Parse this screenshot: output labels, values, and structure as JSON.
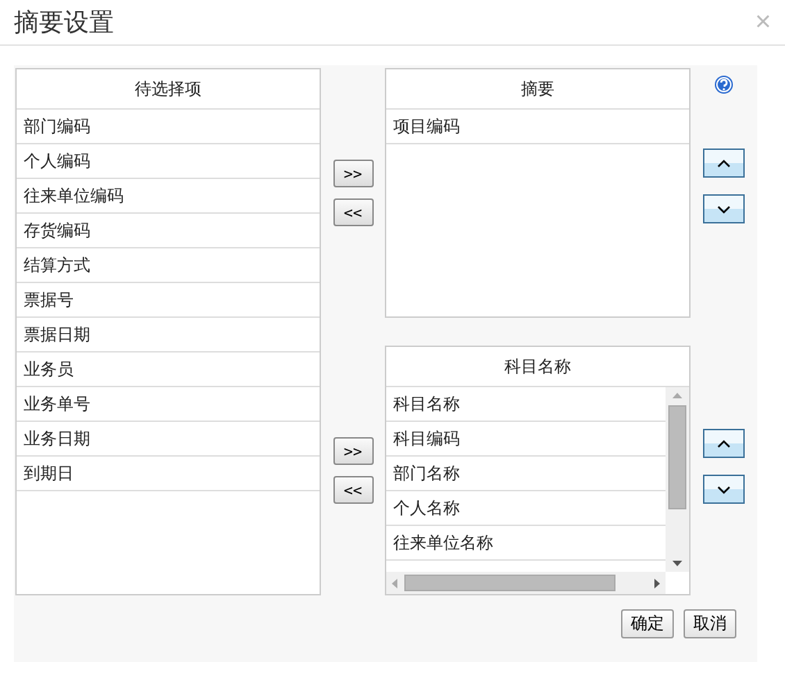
{
  "window": {
    "title": "摘要设置",
    "close": "×"
  },
  "available": {
    "header": "待选择项",
    "items": [
      {
        "label": "部门编码",
        "selected": false
      },
      {
        "label": "个人编码",
        "selected": false
      },
      {
        "label": "往来单位编码",
        "selected": false
      },
      {
        "label": "存货编码",
        "selected": false
      },
      {
        "label": "结算方式",
        "selected": false
      },
      {
        "label": "票据号",
        "selected": false
      },
      {
        "label": "票据日期",
        "selected": false
      },
      {
        "label": "业务员",
        "selected": false
      },
      {
        "label": "业务单号",
        "selected": false
      },
      {
        "label": "业务日期",
        "selected": false
      },
      {
        "label": "到期日",
        "selected": false
      }
    ]
  },
  "summary": {
    "header": "摘要",
    "items": [
      {
        "label": "项目编码",
        "selected": false
      }
    ]
  },
  "subject": {
    "header": "科目名称",
    "items": [
      {
        "label": "科目名称",
        "selected": false
      },
      {
        "label": "科目编码",
        "selected": false
      },
      {
        "label": "部门名称",
        "selected": false
      },
      {
        "label": "个人名称",
        "selected": false
      },
      {
        "label": "往来单位名称",
        "selected": false
      }
    ]
  },
  "transfer_buttons": [
    ">>",
    "<<"
  ],
  "footer_buttons": [
    "确定",
    "取消"
  ]
}
